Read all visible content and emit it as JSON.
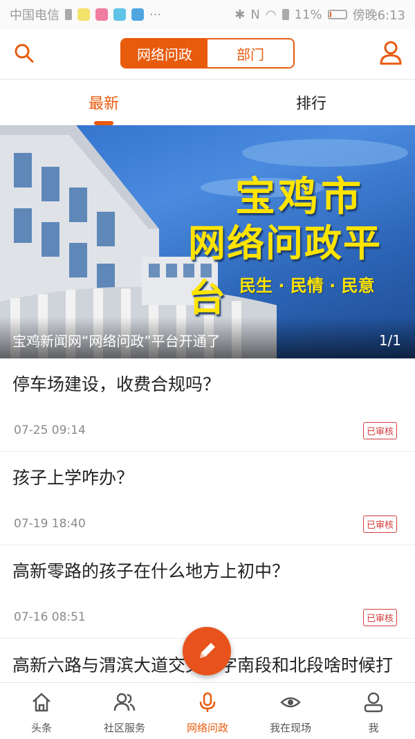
{
  "status_bar": {
    "carrier": "中国电信",
    "battery": "11%",
    "time": "傍晚6:13"
  },
  "header": {
    "segments": [
      "网络问政",
      "部门"
    ],
    "active_segment": 0
  },
  "tabs": [
    "最新",
    "排行"
  ],
  "banner": {
    "title_line1": "宝鸡市",
    "title_line2": "网络问政平台",
    "tagline": "民生 · 民情 · 民意",
    "caption": "宝鸡新闻网“网络问政”平台开通了",
    "page_indicator": "1/1"
  },
  "items": [
    {
      "title": "停车场建设，收费合规吗？",
      "time": "07-25 09:14",
      "status": "已审核"
    },
    {
      "title": "孩子上学咋办？",
      "time": "07-19 18:40",
      "status": "已审核"
    },
    {
      "title": "高新零路的孩子在什么地方上初中？",
      "time": "07-16 08:51",
      "status": "已审核"
    },
    {
      "title": "高新六路与渭滨大道交叉十字南段和北段啥时候打通？",
      "time": "",
      "status": ""
    }
  ],
  "bottom_nav": [
    {
      "label": "头条",
      "icon": "home-icon"
    },
    {
      "label": "社区服务",
      "icon": "people-icon"
    },
    {
      "label": "网络问政",
      "icon": "microphone-icon"
    },
    {
      "label": "我在现场",
      "icon": "eye-icon"
    },
    {
      "label": "我",
      "icon": "person-icon"
    }
  ],
  "colors": {
    "accent": "#e85a0c",
    "badge": "#d23b3b"
  }
}
